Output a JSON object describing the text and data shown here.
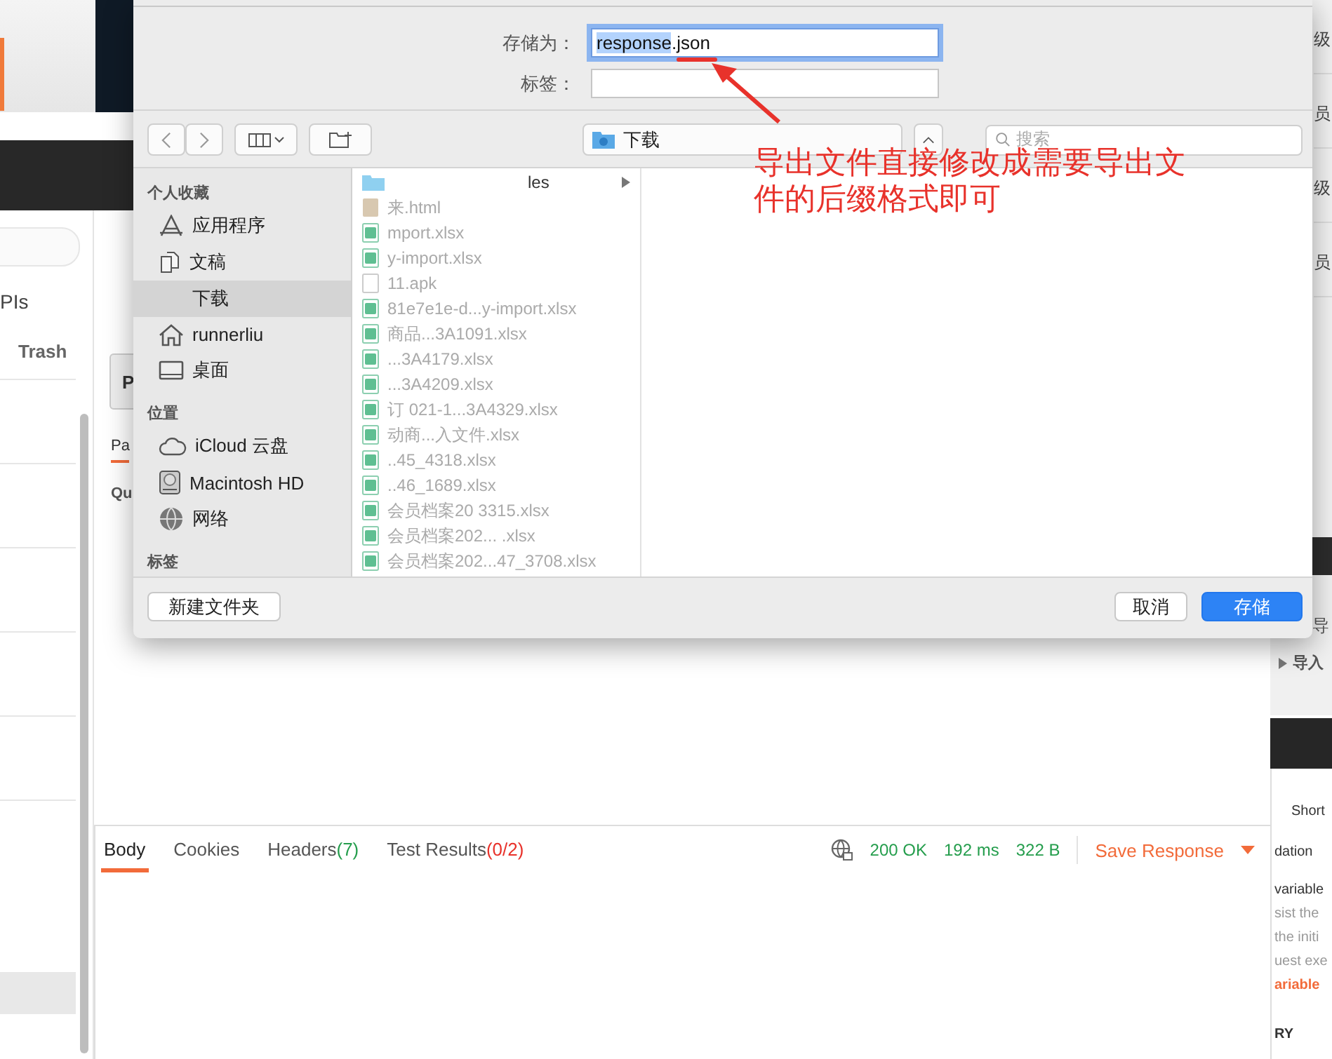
{
  "background_app": {
    "sidebar": {
      "apis_label": "PIs",
      "trash_label": "Trash"
    },
    "request": {
      "button_fragment": "P",
      "tab_fragment": "Pa",
      "section_fragment": "Qu"
    },
    "response": {
      "tabs": [
        {
          "label": "Body",
          "selected": true
        },
        {
          "label": "Cookies",
          "selected": false
        },
        {
          "label": "Headers",
          "count": "(7)",
          "color": "#249d4c",
          "selected": false
        },
        {
          "label": "Test Results",
          "count": "(0/2)",
          "color": "#e8322b",
          "selected": false
        }
      ],
      "status": "200 OK",
      "time": "192 ms",
      "size": "322 B",
      "save_label": "Save Response"
    },
    "right_list": [
      "级",
      "员",
      "级",
      "员"
    ],
    "right_tree": [
      "导",
      "导入"
    ],
    "right_panel": [
      {
        "text": "Short",
        "kind": "plain"
      },
      {
        "text": "dation",
        "kind": "plain"
      },
      {
        "text": "variable",
        "kind": "plain"
      },
      {
        "text": "sist the",
        "kind": "muted"
      },
      {
        "text": "the initi",
        "kind": "muted"
      },
      {
        "text": "uest exe",
        "kind": "muted"
      },
      {
        "text": "ariable",
        "kind": "link"
      },
      {
        "text": "RY",
        "kind": "heading"
      }
    ]
  },
  "dialog": {
    "save_as_label": "存储为：",
    "value_selected": "response",
    "value_rest": ".json",
    "tags_label": "标签：",
    "location": "下载",
    "search_placeholder": "搜索",
    "sidebar": [
      {
        "heading": "个人收藏",
        "items": [
          {
            "label": "应用程序",
            "selected": false
          },
          {
            "label": "文稿",
            "selected": false
          },
          {
            "label": "下载",
            "selected": true
          },
          {
            "label": "runnerliu",
            "selected": false
          },
          {
            "label": "桌面",
            "selected": false
          }
        ]
      },
      {
        "heading": "位置",
        "items": [
          {
            "label": "iCloud 云盘",
            "selected": false
          },
          {
            "label": "Macintosh HD",
            "selected": false
          },
          {
            "label": "网络",
            "selected": false
          }
        ]
      },
      {
        "heading": "标签"
      }
    ],
    "files": [
      {
        "name": "les",
        "kind": "folder"
      },
      {
        "name": "来.html",
        "kind": "html"
      },
      {
        "name": "mport.xlsx",
        "kind": "sheet"
      },
      {
        "name": "y-import.xlsx",
        "kind": "sheet"
      },
      {
        "name": "11.apk",
        "kind": "apk"
      },
      {
        "name": "81e7e1e-d...y-import.xlsx",
        "kind": "sheet"
      },
      {
        "name": "商品...3A1091.xlsx",
        "kind": "sheet"
      },
      {
        "name": "...3A4179.xlsx",
        "kind": "sheet"
      },
      {
        "name": "...3A4209.xlsx",
        "kind": "sheet"
      },
      {
        "name": "订  021-1...3A4329.xlsx",
        "kind": "sheet"
      },
      {
        "name": "动商...入文件.xlsx",
        "kind": "sheet"
      },
      {
        "name": "..45_4318.xlsx",
        "kind": "sheet"
      },
      {
        "name": "..46_1689.xlsx",
        "kind": "sheet"
      },
      {
        "name": "会员档案20      3315.xlsx",
        "kind": "sheet"
      },
      {
        "name": "会员档案202...      .xlsx",
        "kind": "sheet"
      },
      {
        "name": "会员档案202...47_3708.xlsx",
        "kind": "sheet"
      }
    ],
    "new_folder": "新建文件夹",
    "cancel": "取消",
    "save": "存储"
  },
  "annotation": {
    "text": "导出文件直接修改成需要导出文件的后缀格式即可"
  }
}
